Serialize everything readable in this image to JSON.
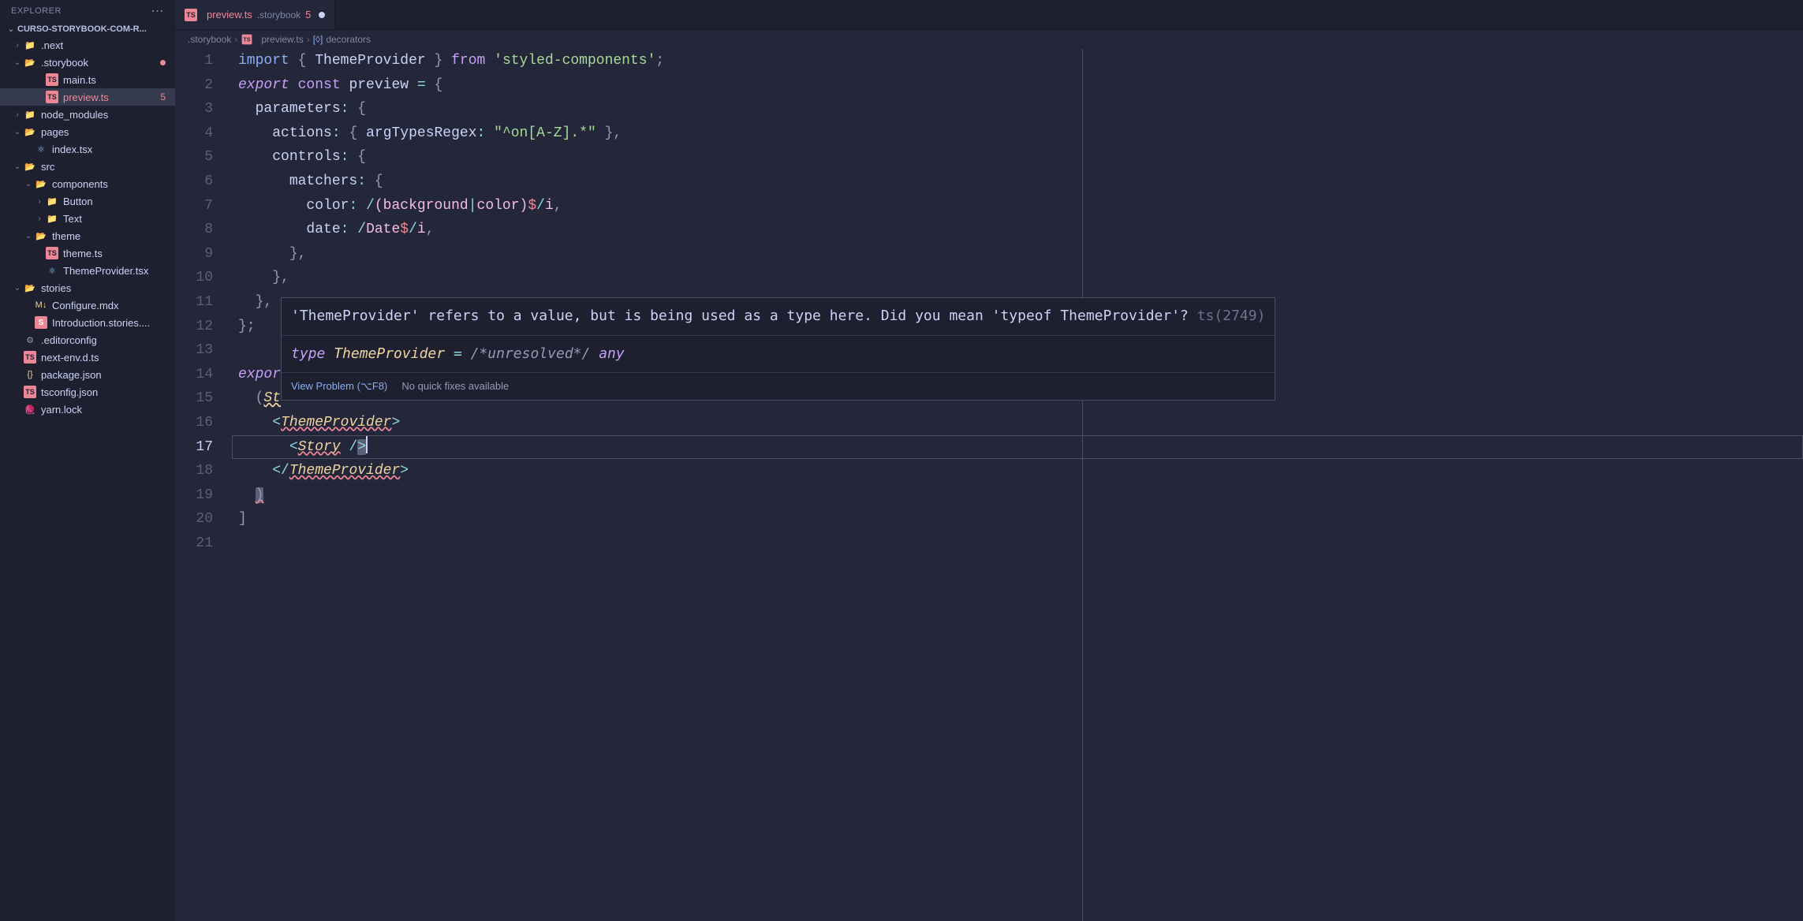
{
  "explorer": {
    "title": "EXPLORER",
    "project": "CURSO-STORYBOOK-COM-R...",
    "tree": [
      {
        "name": ".next",
        "type": "folder",
        "indent": 1,
        "chevron": "›",
        "iconClass": "icon-folder"
      },
      {
        "name": ".storybook",
        "type": "folder",
        "indent": 1,
        "chevron": "⌄",
        "iconClass": "icon-folder-pink",
        "gitDot": true
      },
      {
        "name": "main.ts",
        "type": "file",
        "indent": 3,
        "iconClass": "icon-ts"
      },
      {
        "name": "preview.ts",
        "type": "file",
        "indent": 3,
        "iconClass": "icon-ts",
        "error": true,
        "badge": "5",
        "active": true
      },
      {
        "name": "node_modules",
        "type": "folder",
        "indent": 1,
        "chevron": "›",
        "iconClass": "icon-folder-green"
      },
      {
        "name": "pages",
        "type": "folder",
        "indent": 1,
        "chevron": "⌄",
        "iconClass": "icon-folder"
      },
      {
        "name": "index.tsx",
        "type": "file",
        "indent": 2,
        "iconClass": "icon-react"
      },
      {
        "name": "src",
        "type": "folder",
        "indent": 1,
        "chevron": "⌄",
        "iconClass": "icon-folder-green"
      },
      {
        "name": "components",
        "type": "folder",
        "indent": 2,
        "chevron": "⌄",
        "iconClass": "icon-folder-grey"
      },
      {
        "name": "Button",
        "type": "folder",
        "indent": 3,
        "chevron": "›",
        "iconClass": "icon-folder-grey"
      },
      {
        "name": "Text",
        "type": "folder",
        "indent": 3,
        "chevron": "›",
        "iconClass": "icon-folder-grey"
      },
      {
        "name": "theme",
        "type": "folder",
        "indent": 2,
        "chevron": "⌄",
        "iconClass": "icon-folder-teal"
      },
      {
        "name": "theme.ts",
        "type": "file",
        "indent": 3,
        "iconClass": "icon-ts"
      },
      {
        "name": "ThemeProvider.tsx",
        "type": "file",
        "indent": 3,
        "iconClass": "icon-react"
      },
      {
        "name": "stories",
        "type": "folder",
        "indent": 1,
        "chevron": "⌄",
        "iconClass": "icon-folder-pink"
      },
      {
        "name": "Configure.mdx",
        "type": "file",
        "indent": 2,
        "iconClass": "icon-mdx"
      },
      {
        "name": "Introduction.stories....",
        "type": "file",
        "indent": 2,
        "iconClass": "icon-story"
      },
      {
        "name": ".editorconfig",
        "type": "file",
        "indent": 1,
        "iconClass": "icon-config"
      },
      {
        "name": "next-env.d.ts",
        "type": "file",
        "indent": 1,
        "iconClass": "icon-ts"
      },
      {
        "name": "package.json",
        "type": "file",
        "indent": 1,
        "iconClass": "icon-json"
      },
      {
        "name": "tsconfig.json",
        "type": "file",
        "indent": 1,
        "iconClass": "icon-ts"
      },
      {
        "name": "yarn.lock",
        "type": "file",
        "indent": 1,
        "iconClass": "icon-yarn"
      }
    ]
  },
  "tab": {
    "filename": "preview.ts",
    "path": ".storybook",
    "badge": "5"
  },
  "breadcrumb": {
    "seg1": ".storybook",
    "seg2": "preview.ts",
    "seg3": "decorators"
  },
  "lineNumbers": [
    "1",
    "2",
    "3",
    "4",
    "5",
    "6",
    "7",
    "8",
    "9",
    "10",
    "11",
    "12",
    "13",
    "14",
    "15",
    "16",
    "17",
    "18",
    "19",
    "20",
    "21"
  ],
  "activeLine": 17,
  "code": {
    "l1_import": "import",
    "l1_ident": "ThemeProvider",
    "l1_from": "from",
    "l1_string": "'styled-components'",
    "l2_export": "export",
    "l2_const": "const",
    "l2_ident": "preview",
    "l3_prop": "parameters",
    "l4_prop": "actions",
    "l4_key": "argTypesRegex",
    "l4_val": "\"^on[A-Z].*\"",
    "l5_prop": "controls",
    "l6_prop": "matchers",
    "l7_key": "color",
    "l7_regex_a": "(background",
    "l7_regex_b": "color)",
    "l7_regex_end": "$",
    "l7_flags": "i",
    "l8_key": "date",
    "l8_regex": "Date",
    "l8_regex_end": "$",
    "l8_flags": "i",
    "l14_export": "expor",
    "l15_st": "St",
    "l16_tp": "ThemeProvider",
    "l17_story": "Story",
    "l18_tp": "ThemeProvider"
  },
  "hover": {
    "msg": "'ThemeProvider' refers to a value, but is being used as a type here. Did you mean 'typeof ThemeProvider'?",
    "code": "ts(2749)",
    "type_kw": "type",
    "type_name": "ThemeProvider",
    "type_eq": "=",
    "type_comment": "/*unresolved*/",
    "type_any": "any",
    "view_problem": "View Problem (⌥F8)",
    "no_fix": "No quick fixes available"
  }
}
